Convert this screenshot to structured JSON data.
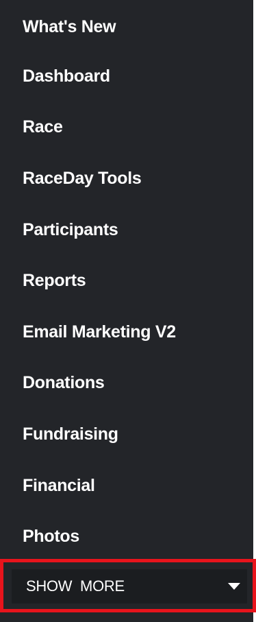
{
  "sidebar": {
    "items": [
      {
        "label": "What's New"
      },
      {
        "label": "Dashboard"
      },
      {
        "label": "Race"
      },
      {
        "label": "RaceDay Tools"
      },
      {
        "label": "Participants"
      },
      {
        "label": "Reports"
      },
      {
        "label": "Email Marketing V2"
      },
      {
        "label": "Donations"
      },
      {
        "label": "Fundraising"
      },
      {
        "label": "Financial"
      },
      {
        "label": "Photos"
      }
    ],
    "show_more": {
      "label": "SHOW MORE",
      "icon": "caret-down-icon"
    }
  },
  "colors": {
    "sidebar_background": "#232529",
    "show_more_background": "#1b1d20",
    "highlight_border": "#e8141c",
    "text": "#ffffff"
  }
}
